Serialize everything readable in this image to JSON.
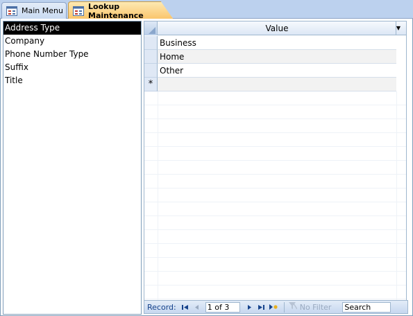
{
  "tabs": [
    {
      "label": "Main Menu",
      "icon": "form-icon",
      "active": false
    },
    {
      "label": "Lookup Maintenance",
      "icon": "form-icon",
      "active": true
    }
  ],
  "lookup_list": {
    "items": [
      "Address Type",
      "Company",
      "Phone Number Type",
      "Suffix",
      "Title"
    ],
    "selected_index": 0
  },
  "datasheet": {
    "column_header": "Value",
    "rows": [
      "Business",
      "Home",
      "Other"
    ],
    "new_row_marker": "*"
  },
  "navigation": {
    "record_label": "Record:",
    "record_position": "1 of 3",
    "filter_label": "No Filter",
    "search_placeholder": "Search"
  },
  "colors": {
    "tabstrip": "#bcd1ee",
    "active_tab": "#fac46a",
    "selection": "#000000"
  }
}
